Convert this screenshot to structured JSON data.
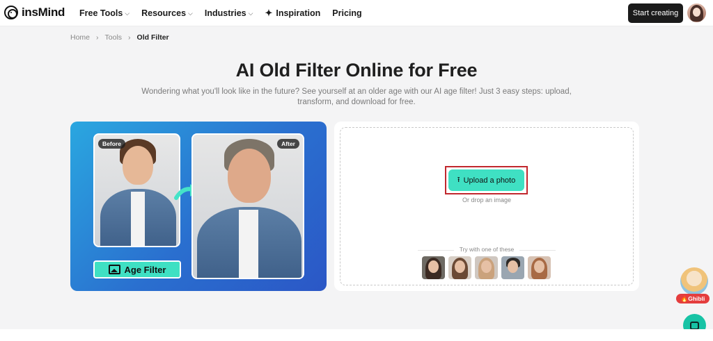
{
  "nav": {
    "logo_text": "insMind",
    "menu": [
      {
        "label": "Free Tools",
        "has_dropdown": true
      },
      {
        "label": "Resources",
        "has_dropdown": true
      },
      {
        "label": "Industries",
        "has_dropdown": true
      },
      {
        "label": "Inspiration",
        "has_dropdown": false
      },
      {
        "label": "Pricing",
        "has_dropdown": false
      }
    ],
    "cta": "Start creating"
  },
  "breadcrumb": [
    "Home",
    "Tools",
    "Old Filter"
  ],
  "hero": {
    "title": "AI Old Filter Online for Free",
    "subtitle": "Wondering what you'll look like in the future? See yourself at an older age with our AI age filter! Just 3 easy steps: upload, transform, and download for free."
  },
  "demo": {
    "before_tag": "Before",
    "after_tag": "After",
    "button": "Age Filter"
  },
  "upload": {
    "button": "Upload a photo",
    "drop_text": "Or drop an image",
    "try_text": "Try with one of these",
    "samples": [
      "sample-1",
      "sample-2",
      "sample-3",
      "sample-4",
      "sample-5"
    ]
  },
  "floating": {
    "ghibli_label": "Ghibli"
  },
  "colors": {
    "accent": "#3fe0c3",
    "dark": "#1b1b1b",
    "highlight_border": "#c1272d"
  }
}
